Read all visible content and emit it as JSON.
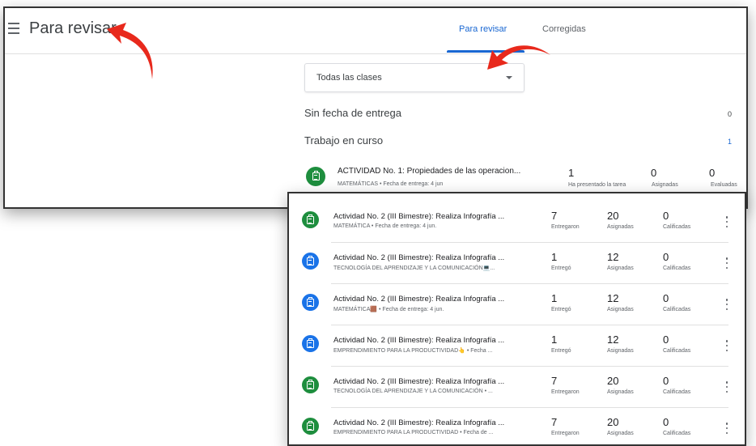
{
  "header": {
    "title": "Para revisar",
    "tabs": [
      {
        "label": "Para revisar",
        "active": true
      },
      {
        "label": "Corregidas",
        "active": false
      }
    ]
  },
  "filter": {
    "selected": "Todas las clases"
  },
  "sections": [
    {
      "label": "Sin fecha de entrega",
      "count": "0"
    },
    {
      "label": "Trabajo en curso",
      "count": "1"
    }
  ],
  "main_assignment": {
    "title": "ACTIVIDAD No. 1: Propiedades de las operacion...",
    "subtitle": "MATEMÁTICAS • Fecha de entrega: 4 jun",
    "stats": [
      {
        "value": "1",
        "label": "Ha presentado la tarea"
      },
      {
        "value": "0",
        "label": "Asignadas"
      },
      {
        "value": "0",
        "label": "Evaluadas"
      }
    ]
  },
  "assignments": [
    {
      "title": "Actividad No. 2 (III Bimestre): Realiza Infografía ...",
      "subtitle": "MATEMÁTICA • Fecha de entrega: 4 jun.",
      "icon_color": "green",
      "stats": [
        {
          "value": "7",
          "label": "Entregaron"
        },
        {
          "value": "20",
          "label": "Asignadas"
        },
        {
          "value": "0",
          "label": "Calificadas"
        }
      ]
    },
    {
      "title": "Actividad No. 2 (III Bimestre): Realiza Infografía ...",
      "subtitle": "TECNOLOGÍA DEL APRENDIZAJE Y LA COMUNICACIÓN💻...",
      "icon_color": "blue",
      "stats": [
        {
          "value": "1",
          "label": "Entregó"
        },
        {
          "value": "12",
          "label": "Asignadas"
        },
        {
          "value": "0",
          "label": "Calificadas"
        }
      ]
    },
    {
      "title": "Actividad No. 2 (III Bimestre): Realiza Infografía ...",
      "subtitle": "MATEMÁTICA🟫 • Fecha de entrega: 4 jun.",
      "icon_color": "blue",
      "stats": [
        {
          "value": "1",
          "label": "Entregó"
        },
        {
          "value": "12",
          "label": "Asignadas"
        },
        {
          "value": "0",
          "label": "Calificadas"
        }
      ]
    },
    {
      "title": "Actividad No. 2 (III Bimestre): Realiza Infografía ...",
      "subtitle": "EMPRENDIMIENTO PARA LA PRODUCTIVIDAD👆 • Fecha ...",
      "icon_color": "blue",
      "stats": [
        {
          "value": "1",
          "label": "Entregó"
        },
        {
          "value": "12",
          "label": "Asignadas"
        },
        {
          "value": "0",
          "label": "Calificadas"
        }
      ]
    },
    {
      "title": "Actividad No. 2 (III Bimestre): Realiza Infografía ...",
      "subtitle": "TECNOLOGÍA DEL APRENDIZAJE Y LA COMUNICACIÓN • ...",
      "icon_color": "green",
      "stats": [
        {
          "value": "7",
          "label": "Entregaron"
        },
        {
          "value": "20",
          "label": "Asignadas"
        },
        {
          "value": "0",
          "label": "Calificadas"
        }
      ]
    },
    {
      "title": "Actividad No. 2 (III Bimestre): Realiza Infografía ...",
      "subtitle": "EMPRENDIMIENTO PARA LA PRODUCTIVIDAD • Fecha de ...",
      "icon_color": "green",
      "stats": [
        {
          "value": "7",
          "label": "Entregaron"
        },
        {
          "value": "20",
          "label": "Asignadas"
        },
        {
          "value": "0",
          "label": "Calificadas"
        }
      ]
    }
  ],
  "colors": {
    "accent": "#1967d2",
    "green_icon": "#1e8e3e",
    "blue_icon": "#1a73e8",
    "arrow": "#e8291c"
  }
}
